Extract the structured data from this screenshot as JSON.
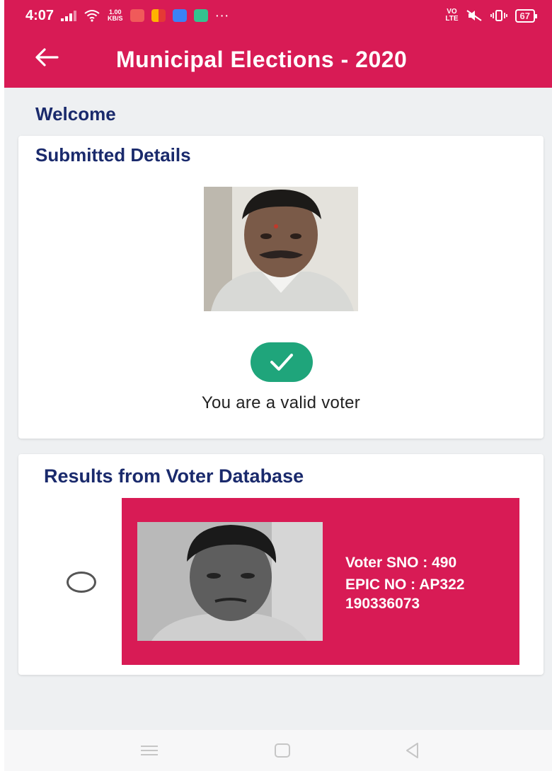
{
  "status_bar": {
    "time": "4:07",
    "net_speed_value": "1.00",
    "net_speed_unit": "KB/S",
    "volte_top": "VO",
    "volte_bottom": "LTE",
    "battery": "67",
    "more": "···"
  },
  "app_bar": {
    "title": "Municipal Elections - 2020",
    "back_icon": "arrow-left-icon"
  },
  "welcome": "Welcome",
  "submitted_card": {
    "title": "Submitted Details",
    "status_icon": "check-circle-icon",
    "status_color": "#1fa57b",
    "status_text": "You are a valid voter"
  },
  "results_card": {
    "title": "Results from Voter Database",
    "results": [
      {
        "selected": false,
        "sno_label": "Voter SNO : ",
        "sno": "490",
        "epic_label": "EPIC NO : ",
        "epic_line1": "AP322",
        "epic_line2": "190336073"
      }
    ]
  },
  "colors": {
    "accent": "#d81b55",
    "heading": "#1a2a6c",
    "success": "#1fa57b",
    "background": "#eef0f2"
  },
  "nav_bar": {
    "icons": [
      "menu-icon",
      "home-icon",
      "back-triangle-icon"
    ]
  }
}
